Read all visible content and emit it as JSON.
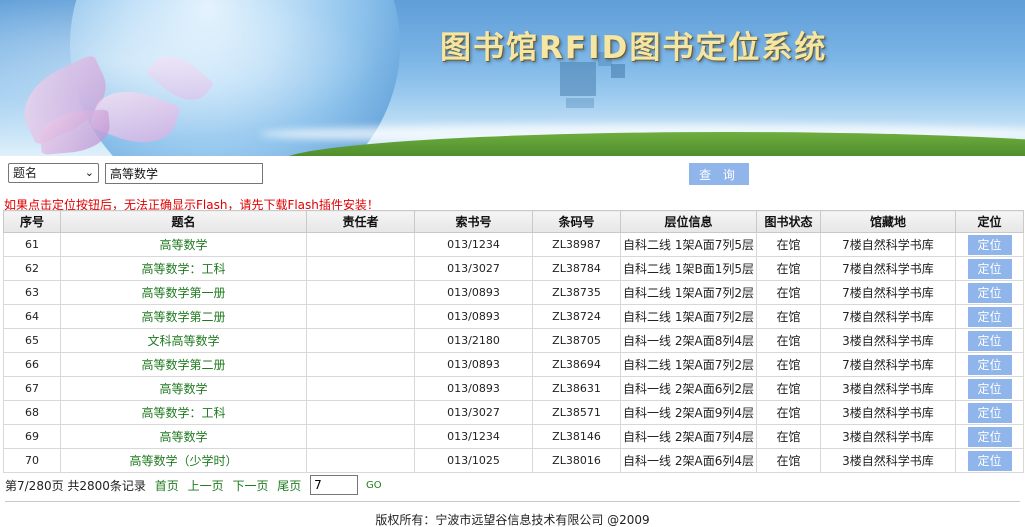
{
  "app": {
    "title": "图书馆RFID图书定位系统"
  },
  "search": {
    "field_options": [
      "题名"
    ],
    "selected_field": "题名",
    "query_value": "高等数学",
    "submit_label": "查 询"
  },
  "notice": "如果点击定位按钮后，无法正确显示Flash，请先下载Flash插件安装！",
  "table": {
    "headers": [
      "序号",
      "题名",
      "责任者",
      "索书号",
      "条码号",
      "层位信息",
      "图书状态",
      "馆藏地",
      "定位"
    ],
    "rows": [
      {
        "no": "61",
        "title": "高等数学",
        "author": "",
        "call_number": "013/1234",
        "barcode": "ZL38987",
        "shelf": "自科二线 1架A面7列5层",
        "status": "在馆",
        "location": "7楼自然科学书库",
        "action": "定位"
      },
      {
        "no": "62",
        "title": "高等数学：工科",
        "author": "",
        "call_number": "013/3027",
        "barcode": "ZL38784",
        "shelf": "自科二线 1架B面1列5层",
        "status": "在馆",
        "location": "7楼自然科学书库",
        "action": "定位"
      },
      {
        "no": "63",
        "title": "高等数学第一册",
        "author": "",
        "call_number": "013/0893",
        "barcode": "ZL38735",
        "shelf": "自科二线 1架A面7列2层",
        "status": "在馆",
        "location": "7楼自然科学书库",
        "action": "定位"
      },
      {
        "no": "64",
        "title": "高等数学第二册",
        "author": "",
        "call_number": "013/0893",
        "barcode": "ZL38724",
        "shelf": "自科二线 1架A面7列2层",
        "status": "在馆",
        "location": "7楼自然科学书库",
        "action": "定位"
      },
      {
        "no": "65",
        "title": "文科高等数学",
        "author": "",
        "call_number": "013/2180",
        "barcode": "ZL38705",
        "shelf": "自科一线 2架A面8列4层",
        "status": "在馆",
        "location": "3楼自然科学书库",
        "action": "定位"
      },
      {
        "no": "66",
        "title": "高等数学第二册",
        "author": "",
        "call_number": "013/0893",
        "barcode": "ZL38694",
        "shelf": "自科二线 1架A面7列2层",
        "status": "在馆",
        "location": "7楼自然科学书库",
        "action": "定位"
      },
      {
        "no": "67",
        "title": "高等数学",
        "author": "",
        "call_number": "013/0893",
        "barcode": "ZL38631",
        "shelf": "自科一线 2架A面6列2层",
        "status": "在馆",
        "location": "3楼自然科学书库",
        "action": "定位"
      },
      {
        "no": "68",
        "title": "高等数学：工科",
        "author": "",
        "call_number": "013/3027",
        "barcode": "ZL38571",
        "shelf": "自科一线 2架A面9列4层",
        "status": "在馆",
        "location": "3楼自然科学书库",
        "action": "定位"
      },
      {
        "no": "69",
        "title": "高等数学",
        "author": "",
        "call_number": "013/1234",
        "barcode": "ZL38146",
        "shelf": "自科一线 2架A面7列4层",
        "status": "在馆",
        "location": "3楼自然科学书库",
        "action": "定位"
      },
      {
        "no": "70",
        "title": "高等数学（少学时）",
        "author": "",
        "call_number": "013/1025",
        "barcode": "ZL38016",
        "shelf": "自科一线 2架A面6列4层",
        "status": "在馆",
        "location": "3楼自然科学书库",
        "action": "定位"
      }
    ]
  },
  "pager": {
    "info": "第7/280页 共2800条记录",
    "first": "首页",
    "prev": "上一页",
    "next": "下一页",
    "last": "尾页",
    "page_value": "7",
    "go": "GO"
  },
  "footer": {
    "copyright": "版权所有：宁波市远望谷信息技术有限公司 @2009"
  },
  "colors": {
    "title_link": "#1f7a1f",
    "button": "#8fb5ea",
    "notice": "#e00000"
  }
}
